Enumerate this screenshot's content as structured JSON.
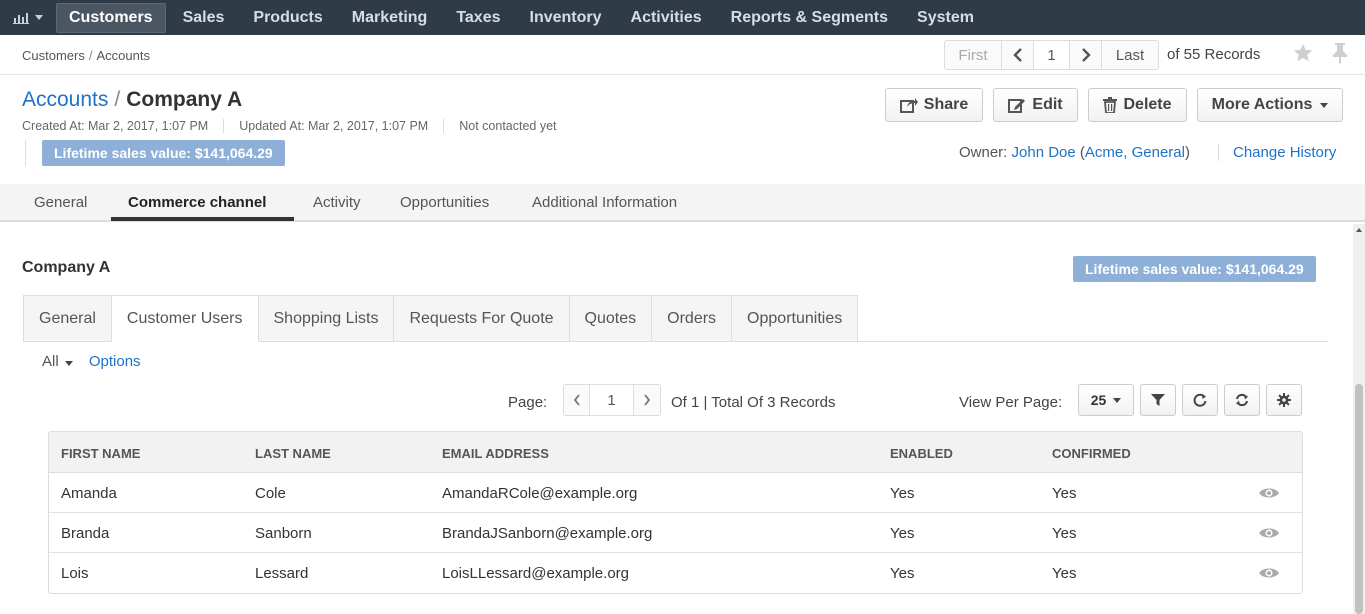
{
  "nav": {
    "items": [
      {
        "label": "Customers",
        "active": true
      },
      {
        "label": "Sales"
      },
      {
        "label": "Products"
      },
      {
        "label": "Marketing"
      },
      {
        "label": "Taxes"
      },
      {
        "label": "Inventory"
      },
      {
        "label": "Activities"
      },
      {
        "label": "Reports & Segments"
      },
      {
        "label": "System"
      }
    ]
  },
  "breadcrumb": {
    "level1": "Customers",
    "level2": "Accounts"
  },
  "record_pager": {
    "first": "First",
    "page": "1",
    "last": "Last",
    "records": "of 55 Records"
  },
  "header": {
    "entity_link": "Accounts",
    "separator": "/",
    "name": "Company A",
    "created": "Created At: Mar 2, 2017, 1:07 PM",
    "updated": "Updated At: Mar 2, 2017, 1:07 PM",
    "contacted": "Not contacted yet",
    "lifetime": "Lifetime sales value: $141,064.29"
  },
  "actions": {
    "share": "Share",
    "edit": "Edit",
    "delete": "Delete",
    "more": "More Actions"
  },
  "owner": {
    "label": "Owner:",
    "name": "John Doe",
    "org": "Acme, General",
    "change_history": "Change History"
  },
  "main_tabs": [
    "General",
    "Commerce channel",
    "Activity",
    "Opportunities",
    "Additional Information"
  ],
  "section": {
    "title": "Company A",
    "lifetime": "Lifetime sales value: $141,064.29"
  },
  "sub_tabs": [
    "General",
    "Customer Users",
    "Shopping Lists",
    "Requests For Quote",
    "Quotes",
    "Orders",
    "Opportunities"
  ],
  "filters": {
    "all": "All",
    "options": "Options"
  },
  "grid_pager": {
    "label": "Page:",
    "page": "1",
    "info": "Of 1 | Total Of 3 Records",
    "view_per_page": "View Per Page:",
    "per_page": "25"
  },
  "table": {
    "columns": [
      "FIRST NAME",
      "LAST NAME",
      "EMAIL ADDRESS",
      "ENABLED",
      "CONFIRMED"
    ],
    "rows": [
      [
        "Amanda",
        "Cole",
        "AmandaRCole@example.org",
        "Yes",
        "Yes"
      ],
      [
        "Branda",
        "Sanborn",
        "BrandaJSanborn@example.org",
        "Yes",
        "Yes"
      ],
      [
        "Lois",
        "Lessard",
        "LoisLLessard@example.org",
        "Yes",
        "Yes"
      ]
    ]
  },
  "colors": {
    "nav_bg": "#2f3b47",
    "link": "#1f72c8",
    "badge": "#8eb0d8"
  }
}
